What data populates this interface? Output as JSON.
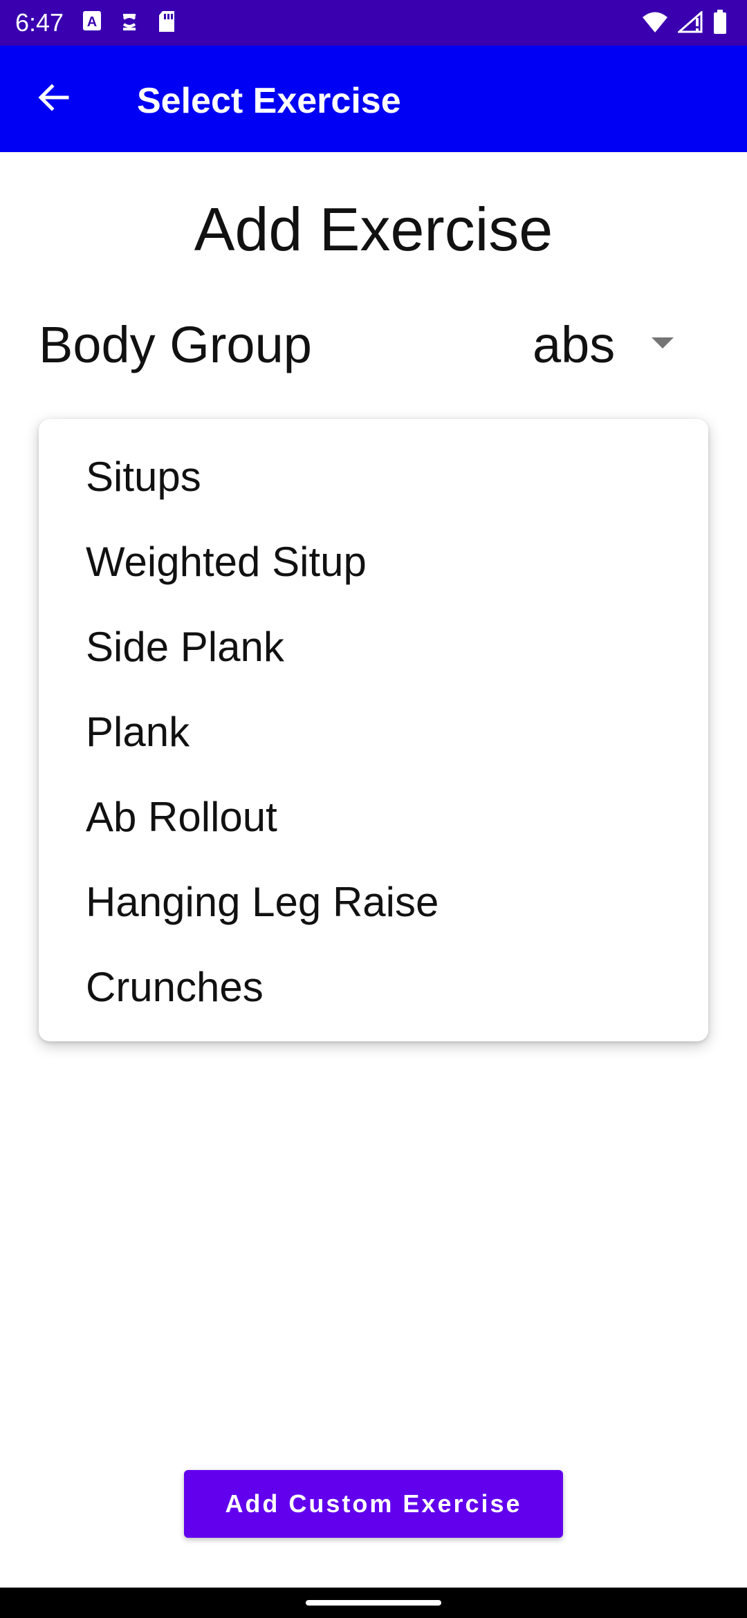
{
  "status_bar": {
    "time": "6:47",
    "left_icons": [
      "a-notification-icon",
      "sync-icon",
      "sd-card-icon"
    ],
    "right_icons": [
      "wifi-icon",
      "signal-icon",
      "battery-icon"
    ],
    "background": "#3a00b0"
  },
  "app_bar": {
    "title": "Select Exercise",
    "back_icon": "arrow-back-icon",
    "background": "#0000f5"
  },
  "page": {
    "title": "Add Exercise",
    "body_group_label": "Body Group",
    "selected_group": "abs"
  },
  "exercise_menu": {
    "items": [
      "Situps",
      "Weighted Situp",
      "Side Plank",
      "Plank",
      "Ab Rollout",
      "Hanging Leg Raise",
      "Crunches"
    ]
  },
  "actions": {
    "add_custom_label": "Add Custom Exercise",
    "accent": "#6200ee"
  }
}
